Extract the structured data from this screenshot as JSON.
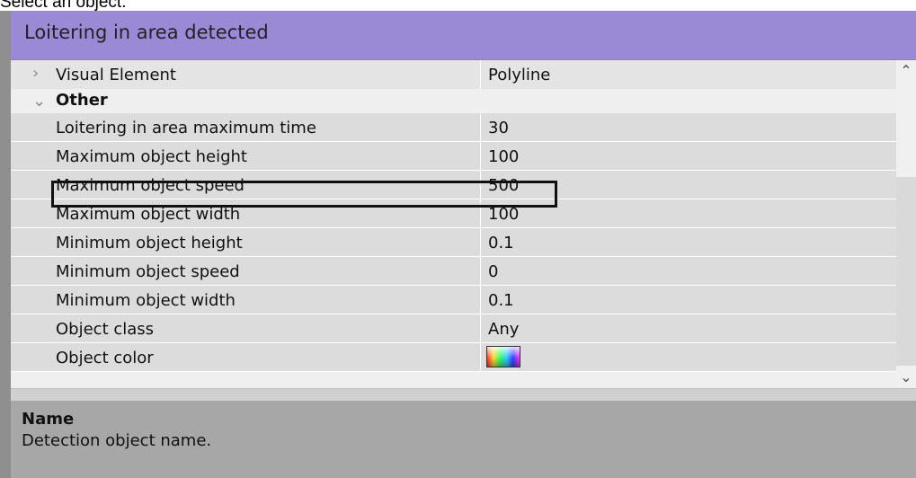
{
  "caption": "Select an object.",
  "panel": {
    "title": "Loitering in area detected",
    "title_bg": "#9a8ad6"
  },
  "grid": {
    "visual_row": {
      "name": "Visual Element",
      "value": "Polyline",
      "expander": "chevron-right-icon"
    },
    "category": {
      "name": "Other",
      "expander": "chevron-down-icon"
    },
    "properties": [
      {
        "name": "Loitering in area maximum time",
        "value": "30"
      },
      {
        "name": "Maximum object height",
        "value": "100"
      },
      {
        "name": "Maximum object speed",
        "value": "500"
      },
      {
        "name": "Maximum object width",
        "value": "100"
      },
      {
        "name": "Minimum object height",
        "value": "0.1"
      },
      {
        "name": "Minimum object speed",
        "value": "0"
      },
      {
        "name": "Minimum object width",
        "value": "0.1"
      },
      {
        "name": "Object class",
        "value": "Any"
      },
      {
        "name": "Object color",
        "value": "",
        "swatch": "rainbow"
      }
    ]
  },
  "description": {
    "title": "Name",
    "text": "Detection object name."
  }
}
